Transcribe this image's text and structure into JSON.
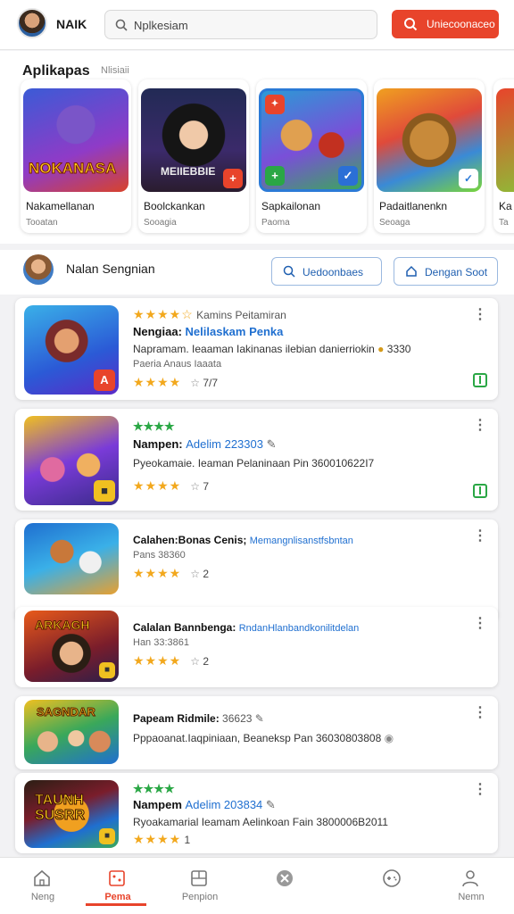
{
  "header": {
    "brand": "NAIK",
    "search_placeholder": "Nplkesiam",
    "cta_label": "Uniecoonaceo"
  },
  "featured": {
    "title": "Aplikapas",
    "subtitle": "Nlisiaii",
    "cards": [
      {
        "name": "Nakamellanan",
        "sub": "Tooatan",
        "art": "NOKANASA"
      },
      {
        "name": "Boolckankan",
        "sub": "Sooagia",
        "art": "MEIIEBBIE"
      },
      {
        "name": "Sapkailonan",
        "sub": "Paoma",
        "art": ""
      },
      {
        "name": "Padaitlanenkn",
        "sub": "Seoaga",
        "art": ""
      },
      {
        "name": "Ka",
        "sub": "Ta",
        "art": ""
      }
    ]
  },
  "list_header": {
    "title": "Nalan Sengnian",
    "button1": "Uedoonbaes",
    "button2": "Dengan Soot"
  },
  "items": [
    {
      "tag": "Kamins  Peitamiran",
      "title": "Nengiaa:",
      "link": "Nelilaskam  Penka",
      "desc": "Napramam. Ieaaman  Iakinanas ilebian danierriokin",
      "desc_extra": "3330",
      "meta": "Paeria Anaus",
      "meta2": "Iaaata",
      "count": "7/7",
      "stars": "★★★★",
      "green": ""
    },
    {
      "tag": "",
      "title": "Nampen:",
      "link": "Adelim 223303",
      "desc": "Pyeokamaie. Ieaman  Pelaninaan Pin 360010622I7",
      "desc_extra": "",
      "meta": "",
      "meta2": "",
      "count": "7",
      "stars": "★★★★",
      "green": "★★★★"
    },
    {
      "tag": "",
      "title": "Calahen:Bonas Cenis;",
      "link": "Memangnlisanstfsbntan",
      "desc": "",
      "desc_extra": "",
      "meta": "Pans 38360",
      "meta2": "",
      "count": "2",
      "stars": "★★★★",
      "green": ""
    },
    {
      "tag": "",
      "title": "Calalan Bannbenga:",
      "link": "RndanHlanbandkonilitdelan",
      "desc": "",
      "desc_extra": "",
      "meta": "Han 33:3861",
      "meta2": "",
      "count": "2",
      "stars": "★★★★",
      "green": ""
    },
    {
      "tag": "",
      "title": "Papeam Ridmile:",
      "link": "",
      "desc": "Pppaoanat.Iaqpiniaan, Beaneksp Pan 36030803808",
      "desc_extra": "",
      "meta": "",
      "meta2": "",
      "count": "",
      "stars": "",
      "green": "",
      "title_extra": "36623"
    },
    {
      "tag": "",
      "title": "Nampem",
      "link": "Adelim 203834",
      "desc": "Ryoakamarial Ieamam  Aelinkoan  Fain 3800006B2011",
      "desc_extra": "",
      "meta": "",
      "meta2": "",
      "count": "1",
      "stars": "★★★★",
      "green": "★★★★"
    }
  ],
  "nav": [
    {
      "label": "Neng"
    },
    {
      "label": "Pema"
    },
    {
      "label": "Penpion"
    },
    {
      "label": ""
    },
    {
      "label": ""
    },
    {
      "label": "Nemn"
    }
  ],
  "colors": {
    "accent": "#e8442b",
    "link": "#1f6fd0",
    "green": "#2aa745",
    "star": "#f2a81d"
  }
}
